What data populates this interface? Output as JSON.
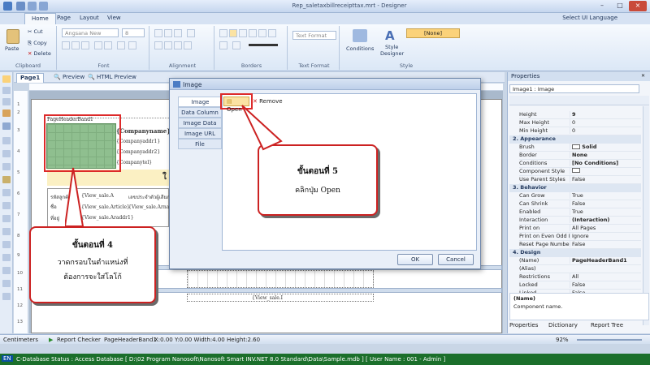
{
  "window": {
    "title": "Rep_saletaxbillreceipttax.mrt - Designer",
    "menu_tabs": [
      "Home",
      "Page",
      "Layout",
      "View"
    ],
    "ui_language": "Select UI Language"
  },
  "ribbon": {
    "clipboard": {
      "group_label": "Clipboard",
      "paste": "Paste",
      "cut": "Cut",
      "copy": "Copy",
      "delete": "Delete"
    },
    "font": {
      "group_label": "Font",
      "font_name": "Angsana New",
      "font_size": "8"
    },
    "alignment": {
      "group_label": "Alignment"
    },
    "borders": {
      "group_label": "Borders"
    },
    "text_format": {
      "group_label": "Text Format",
      "value": "Text Format"
    },
    "style": {
      "group_label": "Style",
      "conditions": "Conditions",
      "style_designer_1": "Style",
      "style_designer_2": "Designer",
      "style_value": "[None]"
    }
  },
  "page_tabs": {
    "page1": "Page1",
    "preview": "Preview",
    "html_preview": "HTML Preview"
  },
  "report": {
    "band_name": "PageHeaderBand1",
    "company_name": "{Companyname}",
    "company_addr1": "{Companyaddr1}",
    "company_addr2": "{Companyaddr2}",
    "company_tel": "{Companytel}",
    "label_code": "รหัสลูกค้า",
    "label_name": "ชื่อ",
    "label_address": "ที่อยู่",
    "label_taxid": "เลขประจำตัวผู้เสียภาษี",
    "field_code": "{View_sale.A",
    "field_article": "{View_sale.Article}",
    "field_arname": "{View_sale.Arnam",
    "field_araddr": "{View_sale.Araddr1}",
    "field_detail": "{View_sale.I",
    "big_letter": "ใ",
    "ruler_marks": [
      "1",
      "2",
      "3",
      "4",
      "5",
      "6",
      "7",
      "8",
      "9",
      "10",
      "11",
      "12",
      "13"
    ]
  },
  "dialog": {
    "title": "Image",
    "tabs": [
      "Image",
      "Data Column",
      "Image Data",
      "Image URL",
      "File"
    ],
    "open_label": "Open",
    "remove_label": "Remove",
    "ok_label": "OK",
    "cancel_label": "Cancel"
  },
  "callouts": {
    "step5_title": "ขั้นตอนที่ 5",
    "step5_text": "คลิกปุ่ม Open",
    "step4_title": "ขั้นตอนที่ 4",
    "step4_line1": "วาดกรอบในตำแหน่งที่",
    "step4_line2": "ต้องการจะใส่โลโก้"
  },
  "properties": {
    "panel_title": "Properties",
    "selector": "Image1 : Image",
    "rows_top": [
      {
        "k": "Height",
        "v": "9"
      },
      {
        "k": "Max Height",
        "v": "0"
      },
      {
        "k": "Min Height",
        "v": "0"
      }
    ],
    "cat2": "2. Appearance",
    "rows_appearance": [
      {
        "k": "Brush",
        "v": "Solid"
      },
      {
        "k": "Border",
        "v": "None"
      },
      {
        "k": "Conditions",
        "v": "[No Conditions]"
      },
      {
        "k": "Component Style",
        "v": ""
      },
      {
        "k": "Use Parent Styles",
        "v": "False"
      }
    ],
    "cat3": "3. Behavior",
    "rows_behavior": [
      {
        "k": "Can Grow",
        "v": "True"
      },
      {
        "k": "Can Shrink",
        "v": "False"
      },
      {
        "k": "Enabled",
        "v": "True"
      },
      {
        "k": "Interaction",
        "v": "(Interaction)"
      },
      {
        "k": "Print on",
        "v": "All Pages"
      },
      {
        "k": "Print on Even Odd Pa",
        "v": "Ignore"
      },
      {
        "k": "Reset Page Number",
        "v": "False"
      }
    ],
    "cat4": "4. Design",
    "rows_design": [
      {
        "k": "(Name)",
        "v": "PageHeaderBand1"
      },
      {
        "k": "(Alias)",
        "v": ""
      },
      {
        "k": "Restrictions",
        "v": "All"
      },
      {
        "k": "Locked",
        "v": "False"
      },
      {
        "k": "Linked",
        "v": "False"
      }
    ],
    "desc_title": "(Name)",
    "desc_text": "Component name.",
    "bottom_tabs": [
      "Properties",
      "Dictionary",
      "Report Tree"
    ]
  },
  "statusbar": {
    "units": "Centimeters",
    "checker": "Report Checker",
    "band": "PageHeaderBand1",
    "coords": "X:0.00  Y:0.00  Width:4.00  Height:2.60",
    "zoom": "92%"
  },
  "taskbar": {
    "lang": "EN",
    "status": "C-Database Status : Access Database [ D:\\02 Program Nanosoft\\Nanosoft Smart INV.NET 8.0 Standard\\Data\\Sample.mdb ]  [ User Name : 001 - Admin ]"
  },
  "colors": {
    "callout_border": "#cc2222",
    "band_fill": "#8fbf8f",
    "taskbar": "#1b6f2b"
  }
}
